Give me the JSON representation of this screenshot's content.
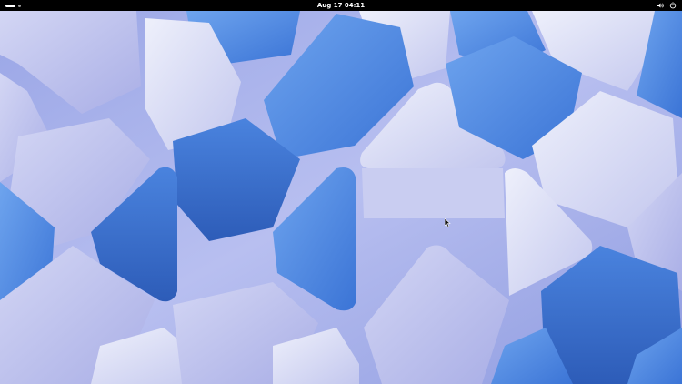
{
  "topbar": {
    "clock": "Aug 17  04:11",
    "icons": [
      "workspace-indicator",
      "volume-icon",
      "power-icon"
    ]
  },
  "desktop": {
    "wallpaper": "blue-3d-shapes",
    "colors": {
      "light": "#dcdff6",
      "lavender": "#b7bbe9",
      "mid": "#8f9be3",
      "blue": "#4f8fe2",
      "deep": "#3a70d0",
      "shadow": "#2f5fb8"
    }
  }
}
